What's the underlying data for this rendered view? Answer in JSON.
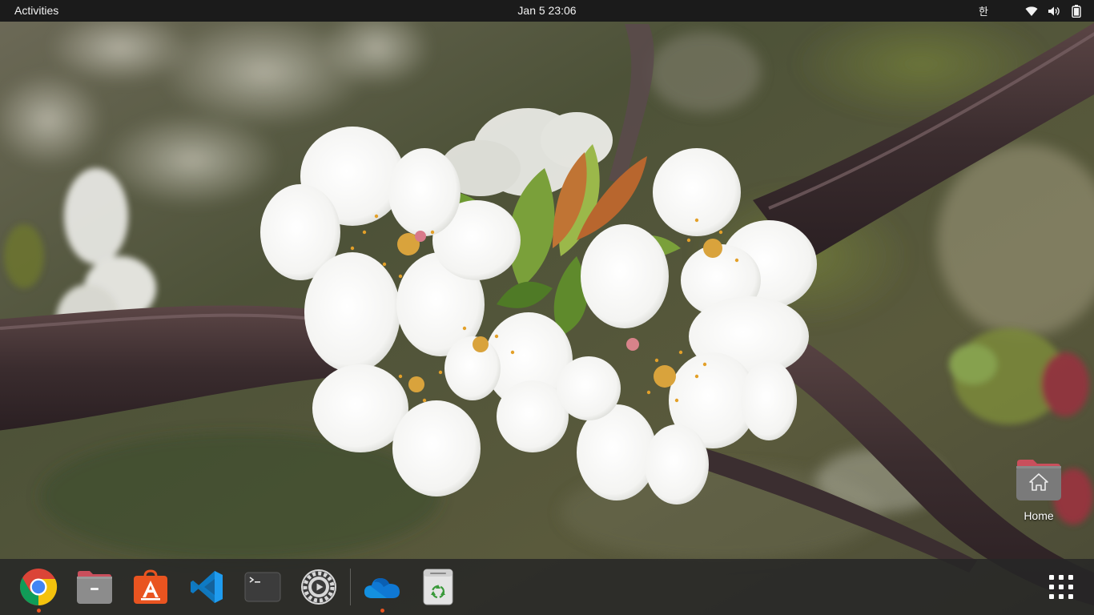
{
  "topbar": {
    "activities_label": "Activities",
    "clock": "Jan 5  23:06",
    "input_method": "한",
    "tray_icons": [
      "wifi-icon",
      "volume-icon",
      "battery-icon"
    ]
  },
  "desktop": {
    "home_label": "Home"
  },
  "dock": {
    "apps": [
      {
        "name": "Google Chrome",
        "icon": "chrome-icon",
        "running": true
      },
      {
        "name": "Files",
        "icon": "files-icon",
        "running": false
      },
      {
        "name": "Ubuntu Software",
        "icon": "software-center-icon",
        "running": false
      },
      {
        "name": "Visual Studio Code",
        "icon": "vscode-icon",
        "running": false
      },
      {
        "name": "Terminal",
        "icon": "terminal-icon",
        "running": false
      },
      {
        "name": "Settings",
        "icon": "settings-icon",
        "running": false
      },
      {
        "name": "OneDrive",
        "icon": "onedrive-icon",
        "running": true
      },
      {
        "name": "Trash",
        "icon": "trash-icon",
        "running": false
      }
    ],
    "show_apps_icon": "app-grid-icon"
  },
  "colors": {
    "topbar_bg": "#1b1b1b",
    "dock_bg": "#262626",
    "accent_orange": "#e95420",
    "folder_top": "#c94f5c",
    "folder_body": "#7a7a7a"
  }
}
